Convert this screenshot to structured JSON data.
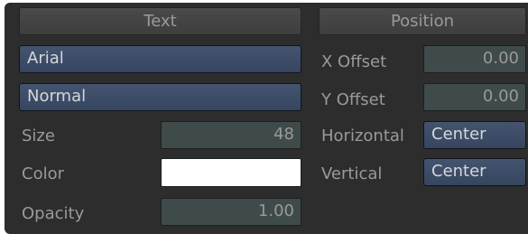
{
  "colors": {
    "panel_bg": "#2d2d2d",
    "button_blue": "#3d4d67",
    "field_bg": "#3f4a4a",
    "label_text": "#9a9a9a",
    "swatch_color": "#ffffff"
  },
  "text_section": {
    "header": "Text",
    "font_value": "Arial",
    "style_value": "Normal",
    "size_label": "Size",
    "size_value": "48",
    "color_label": "Color",
    "opacity_label": "Opacity",
    "opacity_value": "1.00"
  },
  "position_section": {
    "header": "Position",
    "x_offset_label": "X Offset",
    "x_offset_value": "0.00",
    "y_offset_label": "Y Offset",
    "y_offset_value": "0.00",
    "horizontal_label": "Horizontal",
    "horizontal_value": "Center",
    "vertical_label": "Vertical",
    "vertical_value": "Center"
  }
}
